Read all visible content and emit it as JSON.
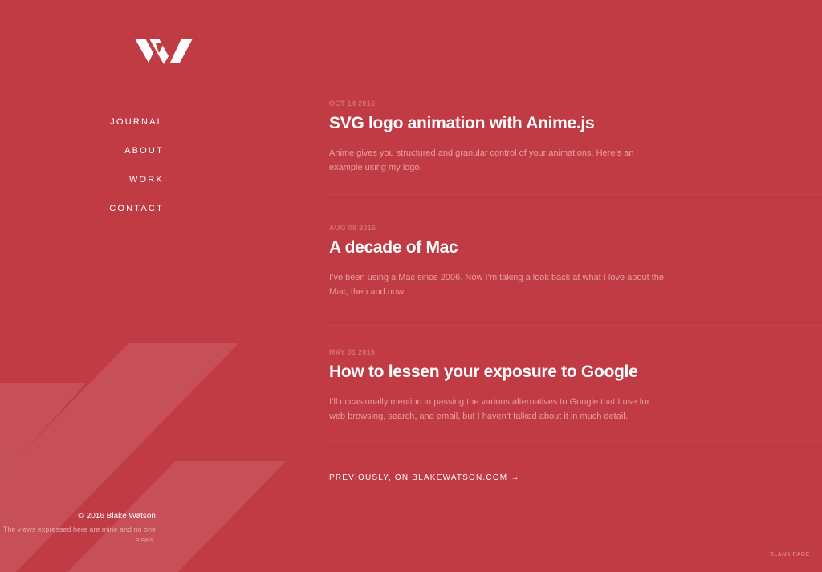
{
  "nav": {
    "items": [
      {
        "label": "JOURNAL"
      },
      {
        "label": "ABOUT"
      },
      {
        "label": "WORK"
      },
      {
        "label": "CONTACT"
      }
    ]
  },
  "posts": [
    {
      "date": "OCT 14 2016",
      "title": "SVG logo animation with Anime.js",
      "excerpt": "Anime gives you structured and granular control of your animations. Here’s an example using my logo."
    },
    {
      "date": "AUG 08 2016",
      "title": "A decade of Mac",
      "excerpt": "I’ve been using a Mac since 2006. Now I’m taking a look back at what I love about the Mac, then and now."
    },
    {
      "date": "MAY 01 2016",
      "title": "How to lessen your exposure to Google",
      "excerpt": "I’ll occasionally mention in passing the various alternatives to Google that I use for web browsing, search, and email, but I haven’t talked about it in much detail."
    }
  ],
  "previously_link": "PREVIOUSLY, ON BLAKEWATSON.COM →",
  "footer": {
    "copyright": "© 2016 Blake Watson",
    "disclaimer": "The views expressed here are mine and no one else’s."
  },
  "corner_label": "BLANK PAGE",
  "colors": {
    "background": "#c13b45",
    "accent_text": "#ffffff",
    "muted_text": "#e89da3",
    "date_text": "#d66e77"
  },
  "icons": {
    "logo": "bw-logo-icon"
  }
}
